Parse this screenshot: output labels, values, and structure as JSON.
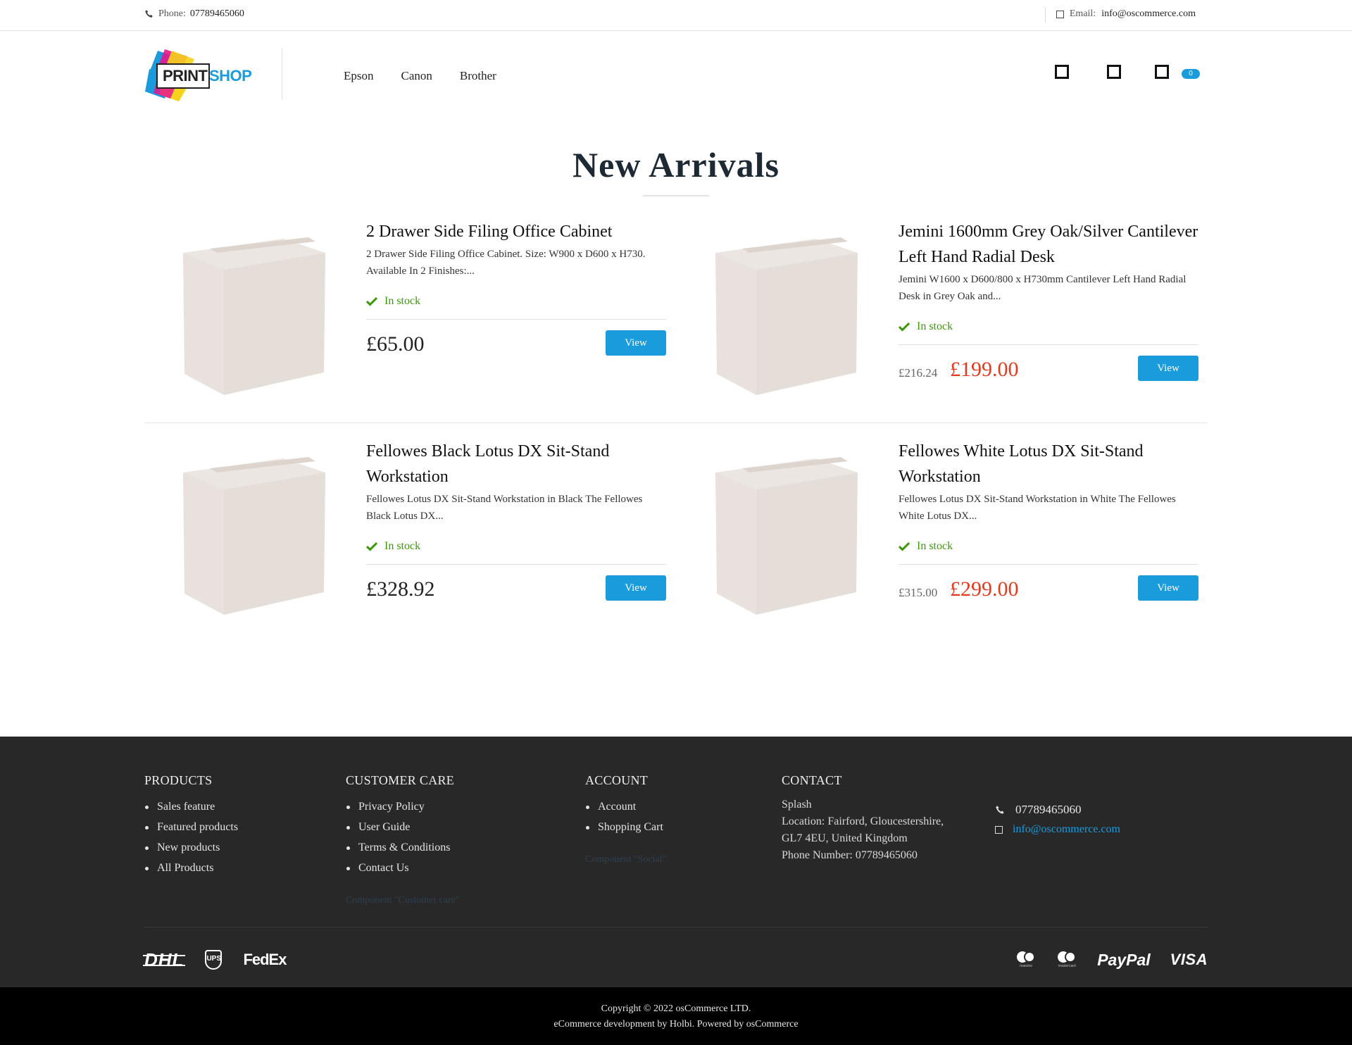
{
  "topbar": {
    "phone_label": "Phone:",
    "phone_value": "07789465060",
    "email_label": "Email:",
    "email_value": "info@oscommerce.com"
  },
  "header": {
    "logo_print": "PRINT",
    "logo_shop": "SHOP",
    "nav": [
      "Epson",
      "Canon",
      "Brother"
    ],
    "cart_count": "0",
    "icons": [
      "user-icon",
      "wishlist-icon",
      "cart-icon"
    ]
  },
  "section": {
    "title": "New Arrivals"
  },
  "products": [
    {
      "name": "2 Drawer Side Filing Office Cabinet",
      "description": "2 Drawer Side Filing Office Cabinet. Size: W900 x D600 x H730. Available In 2 Finishes:...",
      "stock": "In stock",
      "price": "£65.00",
      "old_price": "",
      "button": "View"
    },
    {
      "name": "Jemini 1600mm Grey Oak/Silver Cantilever Left Hand Radial Desk",
      "description": "Jemini W1600 x D600/800 x H730mm Cantilever Left Hand Radial Desk in Grey Oak and...",
      "stock": "In stock",
      "price": "£199.00",
      "old_price": "£216.24",
      "button": "View"
    },
    {
      "name": "Fellowes Black Lotus DX Sit-Stand Workstation",
      "description": "Fellowes Lotus DX Sit-Stand Workstation in Black The Fellowes Black Lotus DX...",
      "stock": "In stock",
      "price": "£328.92",
      "old_price": "",
      "button": "View"
    },
    {
      "name": "Fellowes White Lotus DX Sit-Stand Workstation",
      "description": "Fellowes Lotus DX Sit-Stand Workstation in White The Fellowes White Lotus DX...",
      "stock": "In stock",
      "price": "£299.00",
      "old_price": "£315.00",
      "button": "View"
    }
  ],
  "footer": {
    "products": {
      "title": "PRODUCTS",
      "links": [
        "Sales feature",
        "Featured products",
        "New products",
        "All Products"
      ]
    },
    "customer_care": {
      "title": "CUSTOMER CARE",
      "links": [
        "Privacy Policy",
        "User Guide",
        "Terms & Conditions",
        "Contact Us"
      ],
      "ghost": "Component \"Customer care\""
    },
    "account": {
      "title": "ACCOUNT",
      "links": [
        "Account",
        "Shopping Cart"
      ],
      "ghost": "Component \"Social\""
    },
    "contact": {
      "title": "CONTACT",
      "company": "Splash",
      "location_1": "Location: Fairford, Gloucestershire,",
      "location_2": "GL7 4EU, United Kingdom",
      "phone_line": "Phone Number: 07789465060",
      "phone": "07789465060",
      "email": "info@oscommerce.com"
    },
    "shipping": [
      "DHL",
      "UPS",
      "FedEx"
    ],
    "payments": [
      "maestro",
      "mastercard",
      "PayPal",
      "VISA"
    ],
    "copyright": "Copyright © 2022 osCommerce LTD.",
    "credits": "eCommerce development by Holbi. Powered by osCommerce"
  },
  "colors": {
    "accent": "#1a9bdc",
    "sale": "#e43a1e",
    "stock": "#3a9a06",
    "footer_bg": "#282828"
  }
}
